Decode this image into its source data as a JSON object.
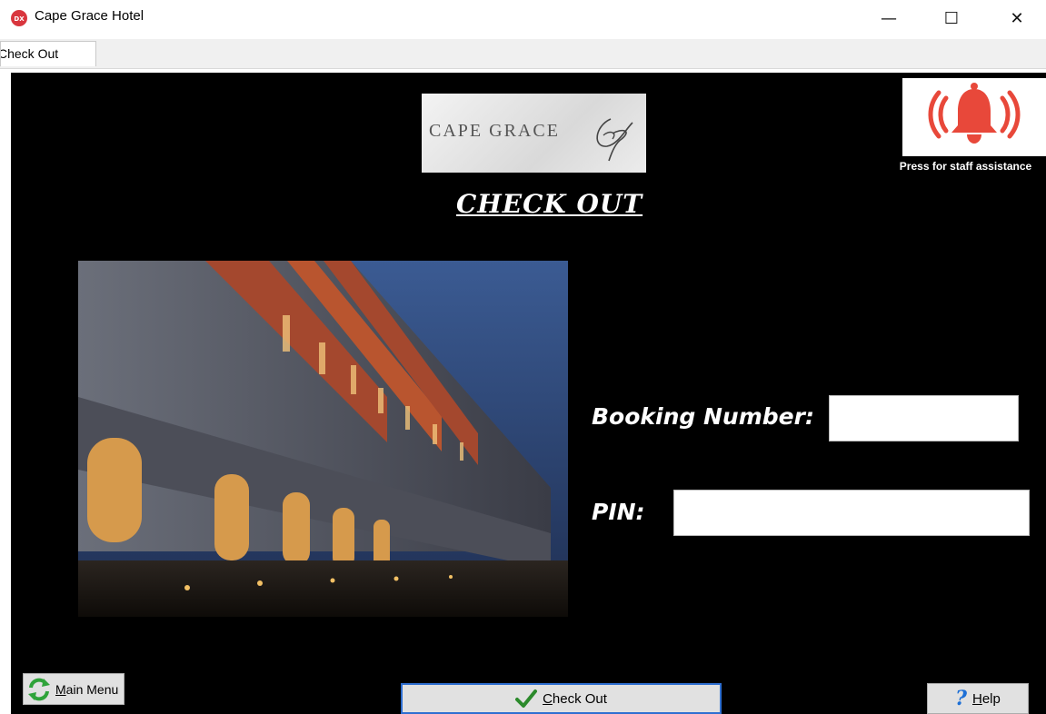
{
  "window": {
    "title": "Cape Grace Hotel",
    "icon_text": "DX",
    "minimize_glyph": "—",
    "maximize_glyph": "☐",
    "close_glyph": "✕"
  },
  "tabs": [
    {
      "label": "Check Out"
    }
  ],
  "logo": {
    "text": "CAPE GRACE"
  },
  "assistance": {
    "caption": "Press for staff assistance",
    "color": "#e8483a"
  },
  "heading": "CHECK OUT",
  "form": {
    "booking_label": "Booking Number:",
    "booking_value": "",
    "pin_label": "PIN:",
    "pin_value": ""
  },
  "buttons": {
    "main_menu": {
      "accel": "M",
      "rest": "ain Menu"
    },
    "check_out": {
      "accel": "C",
      "rest": "heck Out"
    },
    "help": {
      "accel": "H",
      "rest": "elp"
    }
  }
}
